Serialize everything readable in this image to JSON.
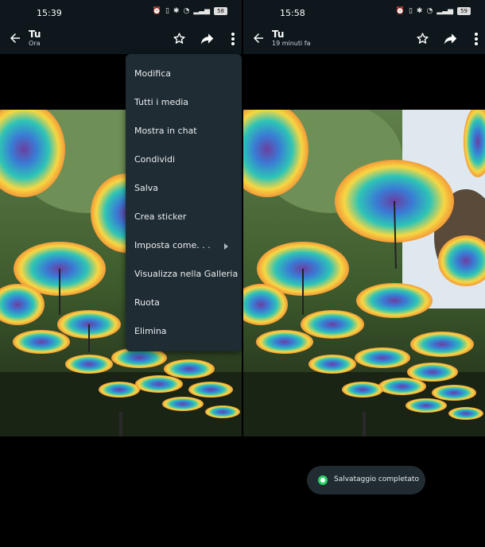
{
  "left": {
    "status": {
      "time": "15:39",
      "battery": "58"
    },
    "header": {
      "title": "Tu",
      "subtitle": "Ora"
    }
  },
  "right": {
    "status": {
      "time": "15:58",
      "battery": "59"
    },
    "header": {
      "title": "Tu",
      "subtitle": "19 minuti fa"
    }
  },
  "menu": {
    "items": [
      {
        "label": "Modifica"
      },
      {
        "label": "Tutti i media"
      },
      {
        "label": "Mostra in chat"
      },
      {
        "label": "Condividi"
      },
      {
        "label": "Salva"
      },
      {
        "label": "Crea sticker"
      },
      {
        "label": "Imposta come. . .",
        "submenu": true
      },
      {
        "label": "Visualizza nella Galleria"
      },
      {
        "label": "Ruota"
      },
      {
        "label": "Elimina"
      }
    ]
  },
  "toast": {
    "message": "Salvataggio completato",
    "icon": "whatsapp-icon"
  },
  "icons": [
    "back-arrow-icon",
    "star-icon",
    "share-icon",
    "more-vert-icon",
    "wifi-icon",
    "signal-icon",
    "battery-icon"
  ],
  "colors": {
    "bar_bg": "#0d171c",
    "menu_bg": "#1f2c33",
    "toast_bg": "#202c32",
    "whatsapp_green": "#25d366"
  }
}
